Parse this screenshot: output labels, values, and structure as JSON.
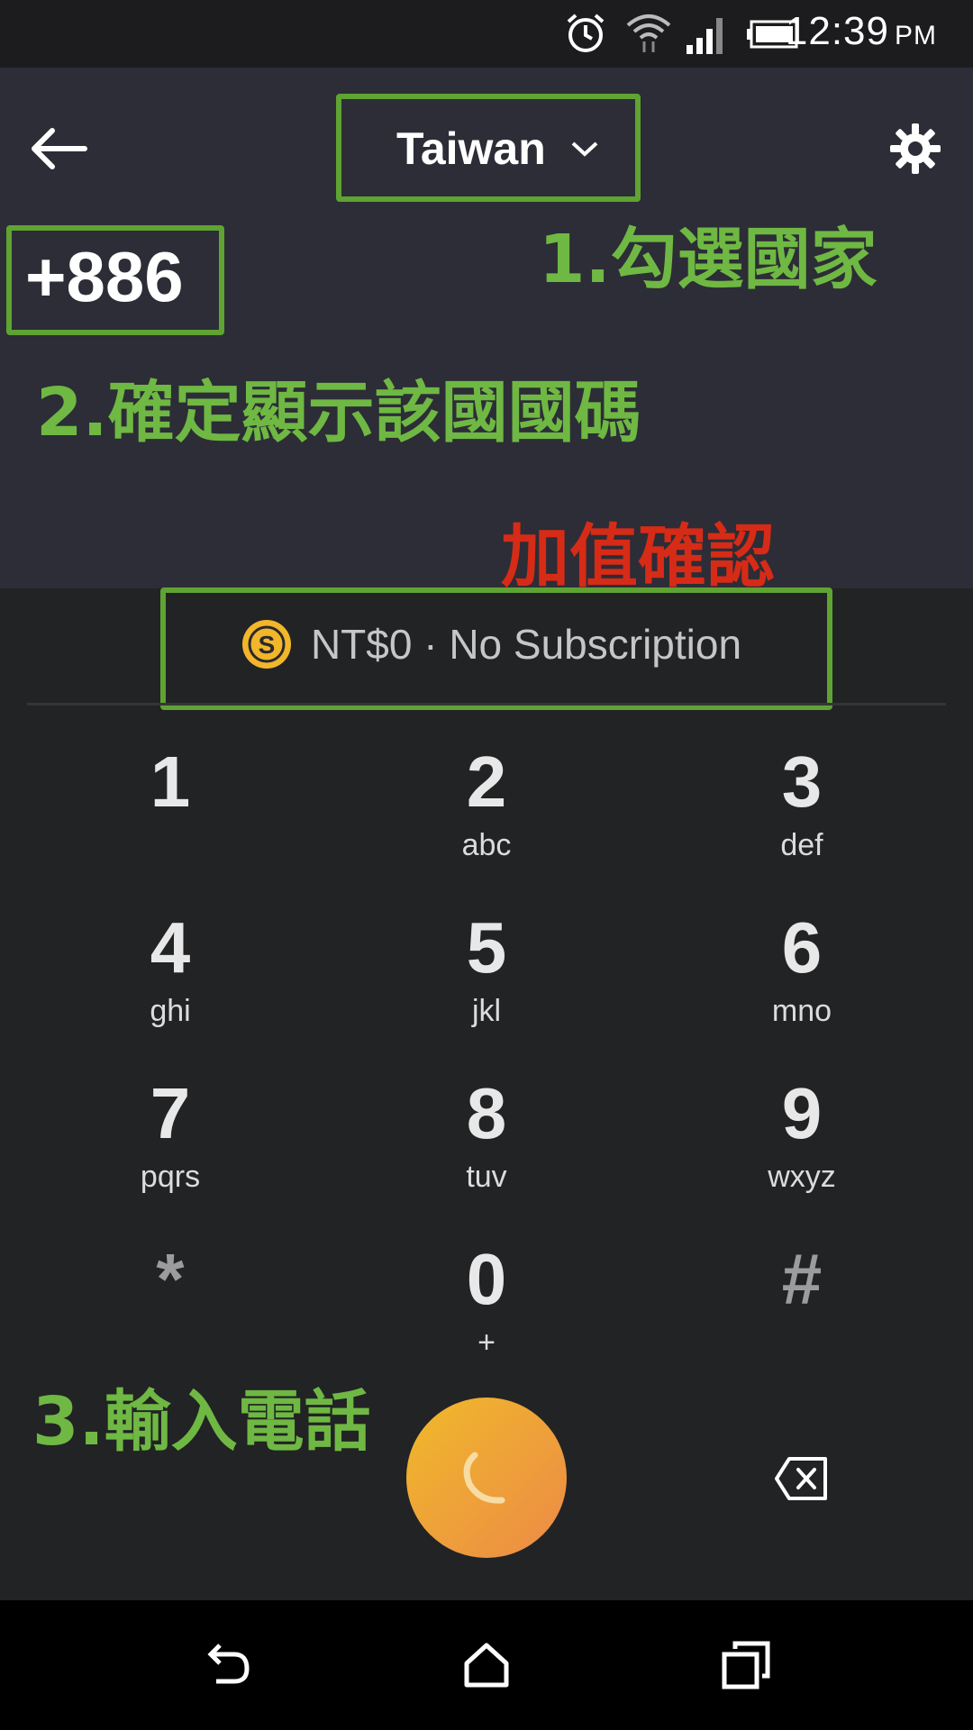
{
  "status_bar": {
    "time": "12:39",
    "ampm": "PM",
    "icons": [
      "alarm-icon",
      "wifi-icon",
      "signal-icon",
      "battery-icon"
    ]
  },
  "header": {
    "country": "Taiwan",
    "dial_code": "+886"
  },
  "annotations": {
    "step1": "1.勾選國家",
    "step2": "2.確定顯示該國國碼",
    "step3": "3.輸入電話",
    "topup": "加值確認"
  },
  "balance": {
    "text": "NT$0 · No Subscription"
  },
  "keypad": [
    {
      "digit": "1",
      "letters": ""
    },
    {
      "digit": "2",
      "letters": "abc"
    },
    {
      "digit": "3",
      "letters": "def"
    },
    {
      "digit": "4",
      "letters": "ghi"
    },
    {
      "digit": "5",
      "letters": "jkl"
    },
    {
      "digit": "6",
      "letters": "mno"
    },
    {
      "digit": "7",
      "letters": "pqrs"
    },
    {
      "digit": "8",
      "letters": "tuv"
    },
    {
      "digit": "9",
      "letters": "wxyz"
    },
    {
      "digit": "*",
      "letters": ""
    },
    {
      "digit": "0",
      "letters": "+"
    },
    {
      "digit": "#",
      "letters": ""
    }
  ],
  "colors": {
    "annotation_green": "#6fb843",
    "annotation_red": "#d62b17",
    "call_button_start": "#f0b92a",
    "call_button_end": "#ec8a47",
    "coin": "#f2b62b"
  }
}
